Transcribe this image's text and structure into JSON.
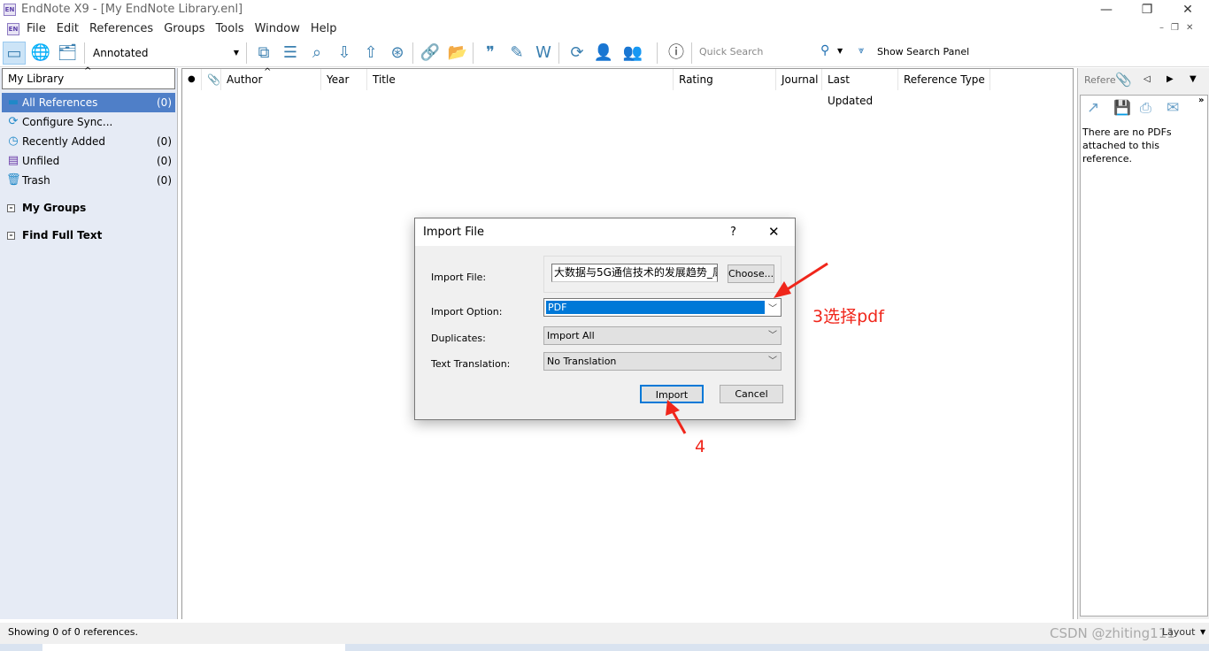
{
  "window": {
    "title": "EndNote X9 - [My EndNote Library.enl]",
    "logo": "EN",
    "controls": [
      "minimize-icon",
      "restore-icon",
      "close-icon"
    ]
  },
  "menu": [
    "File",
    "Edit",
    "References",
    "Groups",
    "Tools",
    "Window",
    "Help"
  ],
  "toolbar": {
    "style": "Annotated",
    "quick_search_placeholder": "Quick Search",
    "show_search_panel": "Show Search Panel"
  },
  "sidebar": {
    "header": "My Library",
    "items": [
      {
        "label": "All References",
        "count": "(0)",
        "icon": "folder-icon"
      },
      {
        "label": "Configure Sync...",
        "count": "",
        "icon": "sync-icon"
      },
      {
        "label": "Recently Added",
        "count": "(0)",
        "icon": "clock-icon"
      },
      {
        "label": "Unfiled",
        "count": "(0)",
        "icon": "unfiled-icon"
      },
      {
        "label": "Trash",
        "count": "(0)",
        "icon": "trash-icon"
      }
    ],
    "groups": [
      "My Groups",
      "Find Full Text"
    ]
  },
  "columns": [
    "Author",
    "Year",
    "Title",
    "Rating",
    "Journal",
    "Last Updated",
    "Reference Type"
  ],
  "right_panel": {
    "tab": "Refere",
    "message": "There are no PDFs attached to this reference."
  },
  "status": {
    "text": "Showing 0 of 0 references.",
    "layout": "Layout",
    "watermark": "CSDN @zhiting111"
  },
  "dialog": {
    "title": "Import File",
    "help": "?",
    "import_file_label": "Import File:",
    "import_file_value": "大数据与5G通信技术的发展趋势_周",
    "choose": "Choose...",
    "import_option_label": "Import Option:",
    "import_option_value": "PDF",
    "duplicates_label": "Duplicates:",
    "duplicates_value": "Import All",
    "translation_label": "Text Translation:",
    "translation_value": "No Translation",
    "import_btn": "Import",
    "cancel_btn": "Cancel"
  },
  "annotations": {
    "step3": "3选择pdf",
    "step4": "4",
    "color": "#f0261b"
  },
  "colors": {
    "selection": "#4f7fc8",
    "dropdown_selected": "#0078d7",
    "sidebar_bg": "#e6ebf5"
  }
}
